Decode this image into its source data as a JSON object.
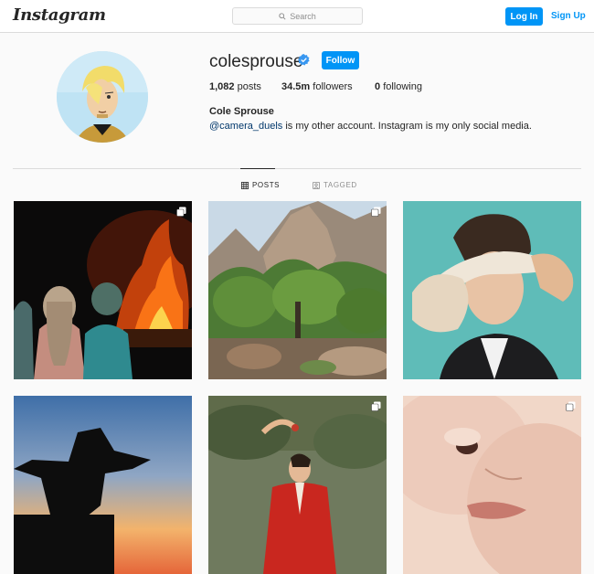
{
  "header": {
    "logo_text": "Instagram",
    "search_placeholder": "Search",
    "login_label": "Log In",
    "signup_label": "Sign Up",
    "accent_color": "#0095f6"
  },
  "profile": {
    "username": "colesprouse",
    "verified": true,
    "follow_label": "Follow",
    "posts_count": "1,082",
    "posts_label": "posts",
    "followers_count": "34.5m",
    "followers_label": "followers",
    "following_count": "0",
    "following_label": "following",
    "full_name": "Cole Sprouse",
    "bio_mention": "@camera_duels",
    "bio_text": " is my other account. Instagram is my only social media."
  },
  "tabs": [
    {
      "label": "POSTS",
      "icon": "grid-icon",
      "active": true
    },
    {
      "label": "TAGGED",
      "icon": "tag-icon",
      "active": false
    }
  ],
  "posts": [
    {
      "subject": "couple watching fire at night",
      "multi": true
    },
    {
      "subject": "canyon mountains with trees",
      "multi": true
    },
    {
      "subject": "man covering eyes with bag",
      "multi": false
    },
    {
      "subject": "cowboy silhouette at sunset",
      "multi": false
    },
    {
      "subject": "man in red jacket by water",
      "multi": true
    },
    {
      "subject": "close-up of face",
      "multi": true
    }
  ]
}
